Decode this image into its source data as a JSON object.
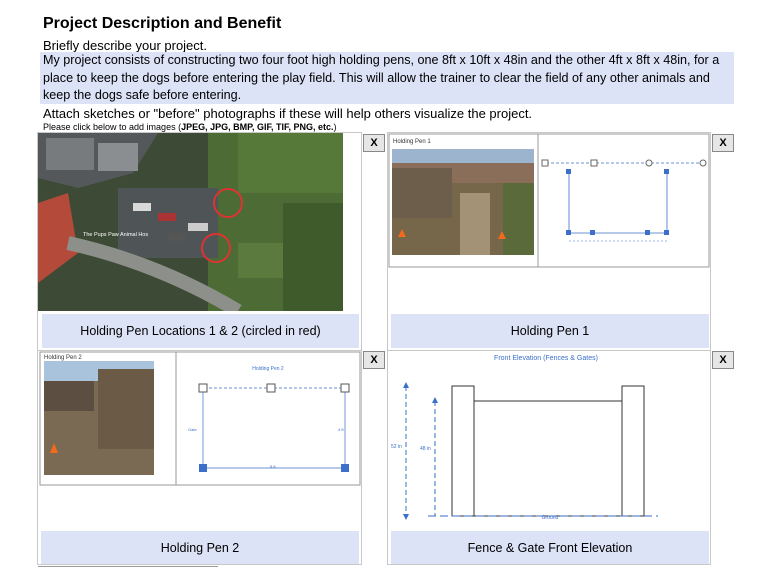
{
  "section": {
    "title": "Project Description and Benefit",
    "prompt": "Briefly describe your project.",
    "description": "My project consists of constructing two four foot high holding pens, one 8ft x 10ft x 48in and the other 4ft x 8ft x 48in, for a place to keep the dogs before entering the play field. This will allow the trainer to clear the field of any other animals and keep the dogs safe before entering.",
    "attach_prompt": "Attach sketches or \"before\" photographs if these will help others visualize the project.",
    "hint_prefix": "Please click below to add images (",
    "hint_formats": "JPEG, JPG, BMP, GIF, TIF, PNG, etc.",
    "hint_suffix": ")"
  },
  "images": [
    {
      "caption": "Holding Pen Locations 1 & 2 (circled in red)",
      "remove_label": "X",
      "map_label": "The Pups Paw Animal Hos"
    },
    {
      "caption": "Holding Pen 1",
      "remove_label": "X",
      "inner_title": "Holding Pen 1"
    },
    {
      "caption": "Holding Pen 2",
      "remove_label": "X",
      "inner_title": "Holding Pen 2",
      "sketch_title": "Holding Pen 2",
      "sketch_label_a": "Gate",
      "sketch_label_b": "8 ft",
      "sketch_label_c": "4 ft"
    },
    {
      "caption": "Fence & Gate Front Elevation",
      "remove_label": "X",
      "sketch_title": "Front Elevation (Fences & Gates)",
      "label_52": "52 in",
      "label_48": "48 in",
      "label_ground": "Ground"
    }
  ],
  "colors": {
    "caption_bg": "#dce3f7",
    "description_bg": "#dce3f7",
    "sketch_blue": "#3b6fc9",
    "marker_red": "#c0392b"
  }
}
